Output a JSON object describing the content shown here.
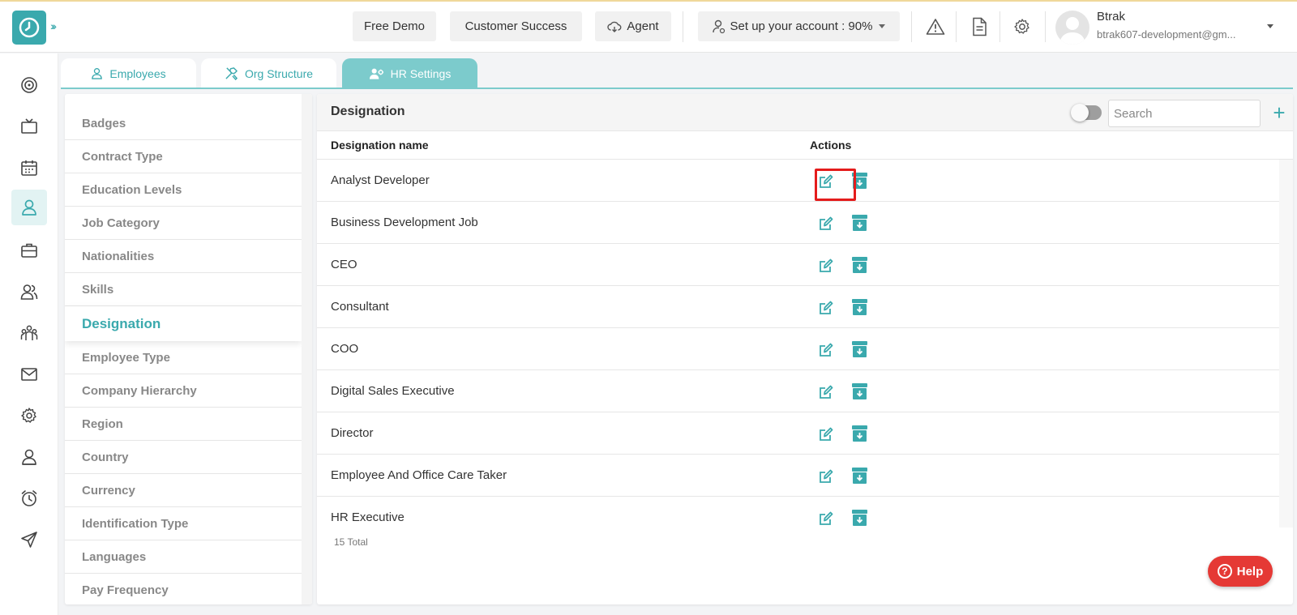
{
  "topbar": {
    "free_demo": "Free Demo",
    "customer_success": "Customer Success",
    "agent": "Agent",
    "setup": "Set up your account : 90%",
    "user_name": "Btrak",
    "user_email": "btrak607-development@gm..."
  },
  "tabs": [
    {
      "label": "Employees",
      "icon": "user-icon"
    },
    {
      "label": "Org Structure",
      "icon": "tools-icon"
    },
    {
      "label": "HR Settings",
      "icon": "users-gear-icon",
      "active": true
    }
  ],
  "settings": {
    "items": [
      "Badges",
      "Contract Type",
      "Education Levels",
      "Job Category",
      "Nationalities",
      "Skills",
      "Designation",
      "Employee Type",
      "Company Hierarchy",
      "Region",
      "Country",
      "Currency",
      "Identification Type",
      "Languages",
      "Pay Frequency"
    ],
    "active": "Designation"
  },
  "main": {
    "title": "Designation",
    "search_placeholder": "Search",
    "col_name": "Designation name",
    "col_actions": "Actions",
    "rows": [
      "Analyst Developer",
      "Business Development Job",
      "CEO",
      "Consultant",
      "COO",
      "Digital Sales Executive",
      "Director",
      "Employee And Office Care Taker",
      "HR Executive"
    ],
    "total": "15 Total"
  },
  "help": "Help",
  "colors": {
    "accent": "#3aa9ad",
    "tab_active": "#7ccbcc",
    "highlight": "#e41c1c",
    "help": "#e53935"
  }
}
